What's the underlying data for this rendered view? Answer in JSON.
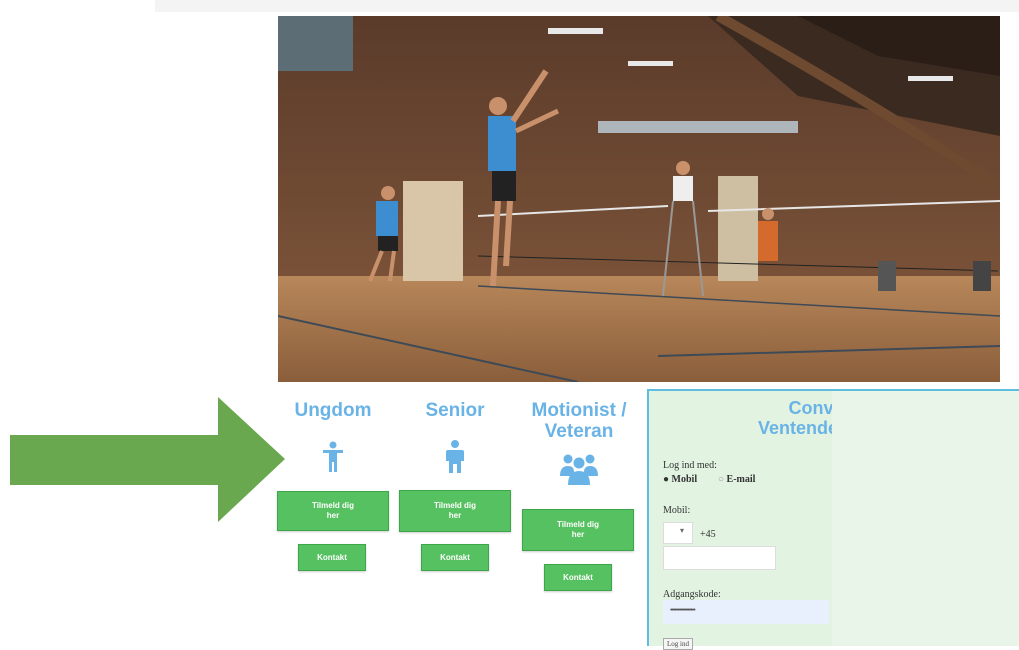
{
  "columns": [
    {
      "title": "Ungdom",
      "icon": "child-icon",
      "signup_label": "Tilmeld dig her",
      "contact_label": "Kontakt"
    },
    {
      "title": "Senior",
      "icon": "person-icon",
      "signup_label": "Tilmeld dig her",
      "contact_label": "Kontakt"
    },
    {
      "title": "Motionist / Veteran",
      "icon": "group-icon",
      "signup_label": "Tilmeld dig her",
      "contact_label": "Kontakt"
    }
  ],
  "panel": {
    "title_line1": "Conventus",
    "title_line2": "Ventende betaling",
    "login_label": "Log ind med:",
    "option_mobile": "Mobil",
    "option_email": "E-mail",
    "mobile_label": "Mobil:",
    "country_code": "+45",
    "password_label": "Adgangskode:",
    "password_mask": "•••••••••••••••••",
    "submit_label": "Log ind"
  },
  "colors": {
    "accent_blue": "#6ab3e6",
    "button_green": "#56c161",
    "arrow_green": "#6aa84f",
    "panel_bg": "#e2f3e2"
  }
}
